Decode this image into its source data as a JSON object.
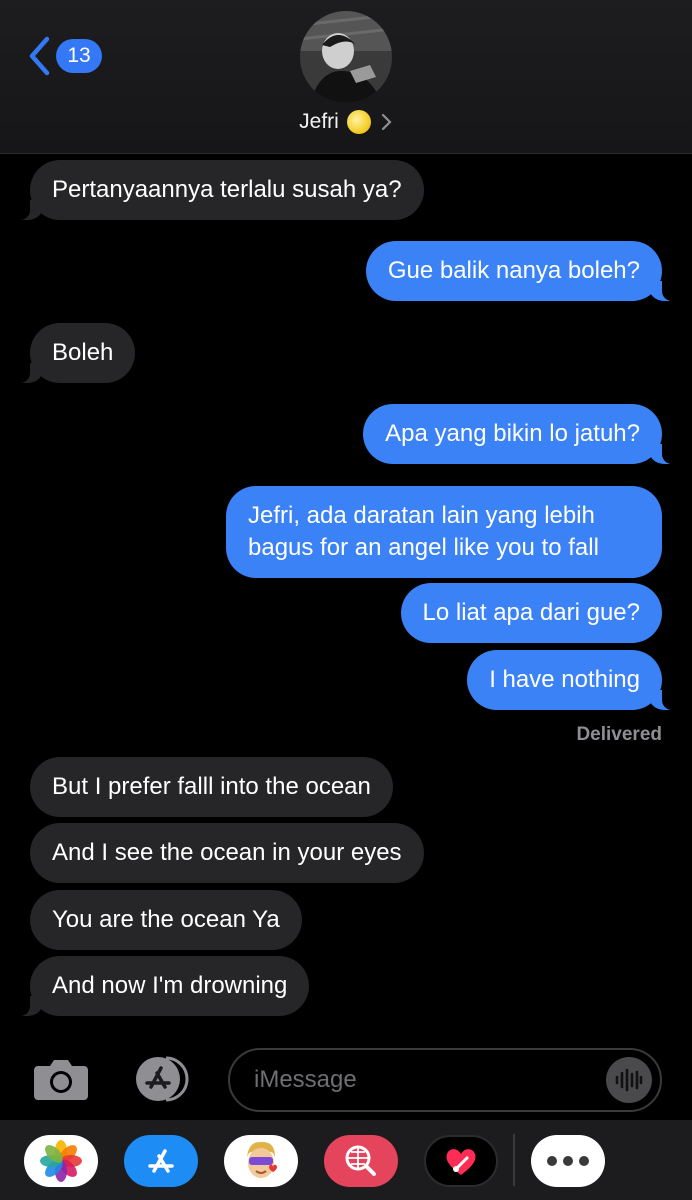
{
  "header": {
    "back_count": "13",
    "contact_name": "Jefri",
    "contact_emoji_icon": "moon-icon"
  },
  "messages": [
    {
      "dir": "in",
      "text": "Pertanyaannya terlalu susah ya?"
    },
    {
      "dir": "out",
      "text": "Gue balik nanya boleh?"
    },
    {
      "dir": "in",
      "text": "Boleh"
    },
    {
      "dir": "out",
      "text": "Apa yang bikin lo jatuh?"
    },
    {
      "dir": "out",
      "text": "Jefri, ada daratan lain yang lebih bagus for an angel like you to fall"
    },
    {
      "dir": "out",
      "text": "Lo liat apa dari gue?"
    },
    {
      "dir": "out",
      "text": "I have nothing"
    },
    {
      "dir": "in",
      "text": "But I prefer falll into the ocean"
    },
    {
      "dir": "in",
      "text": "And I see the ocean in your eyes"
    },
    {
      "dir": "in",
      "text": "You are the ocean Ya"
    },
    {
      "dir": "in",
      "text": "And now I'm drowning"
    }
  ],
  "status": {
    "delivered": "Delivered"
  },
  "composer": {
    "placeholder": "iMessage"
  },
  "colors": {
    "accent": "#3478f6",
    "incoming_bubble": "#262628",
    "outgoing_bubble": "#3b82f6"
  },
  "app_drawer": [
    "photos-app",
    "app-store-app",
    "memoji-app",
    "image-search-app",
    "digital-touch-app",
    "more-apps"
  ]
}
